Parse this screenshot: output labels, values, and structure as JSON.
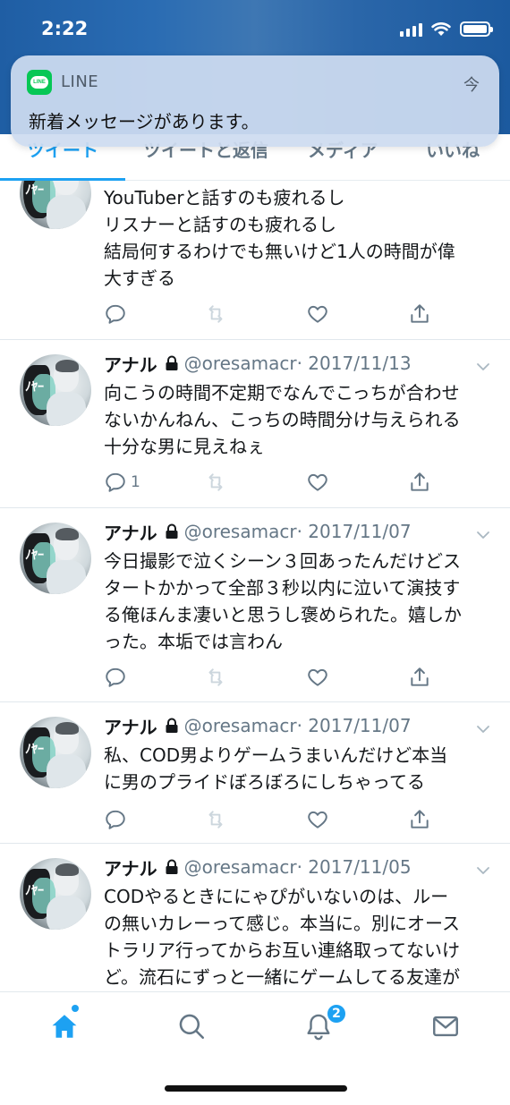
{
  "status_bar": {
    "time": "2:22"
  },
  "notification": {
    "app_name": "LINE",
    "app_icon_text": "LINE",
    "time": "今",
    "message": "新着メッセージがあります。"
  },
  "tabs": [
    {
      "label": "ツイート"
    },
    {
      "label": "ツイートと返信"
    },
    {
      "label": "メディア"
    },
    {
      "label": "いいね"
    }
  ],
  "avatar_overlay_text": "ﾉﾔｰ",
  "tweets": [
    {
      "name": "",
      "handle": "",
      "date": "",
      "text": "YouTuberと話すのも疲れるし\nリスナーと話すのも疲れるし\n結局何するわけでも無いけど1人の時間が偉\n大すぎる",
      "reply_count": ""
    },
    {
      "name": "アナル",
      "handle": "@oresamacr",
      "date": "· 2017/11/13",
      "text": "向こうの時間不定期でなんでこっちが合わせ\nないかんねん、こっちの時間分け与えられる\n十分な男に見えねぇ",
      "reply_count": "1"
    },
    {
      "name": "アナル",
      "handle": "@oresamacr",
      "date": "· 2017/11/07",
      "text": "今日撮影で泣くシーン３回あったんだけどス\nタートかかって全部３秒以内に泣いて演技す\nる俺ほんま凄いと思うし褒められた。嬉しか\nった。本垢では言わん",
      "reply_count": ""
    },
    {
      "name": "アナル",
      "handle": "@oresamacr",
      "date": "· 2017/11/07",
      "text": "私、COD男よりゲームうまいんだけど本当\nに男のプライドぼろぼろにしちゃってる",
      "reply_count": ""
    },
    {
      "name": "アナル",
      "handle": "@oresamacr",
      "date": "· 2017/11/05",
      "text": "CODやるときににゃぴがいないのは、ルー\nの無いカレーって感じ。本当に。別にオース\nトラリア行ってからお互い連絡取ってないけ\nど。流石にずっと一緒にゲームしてる友達が",
      "reply_count": ""
    }
  ],
  "bottom_nav": {
    "notification_badge": "2"
  },
  "colors": {
    "accent": "#1da1f2",
    "line_green": "#06c755",
    "header_blue": "#2a6cb3"
  }
}
